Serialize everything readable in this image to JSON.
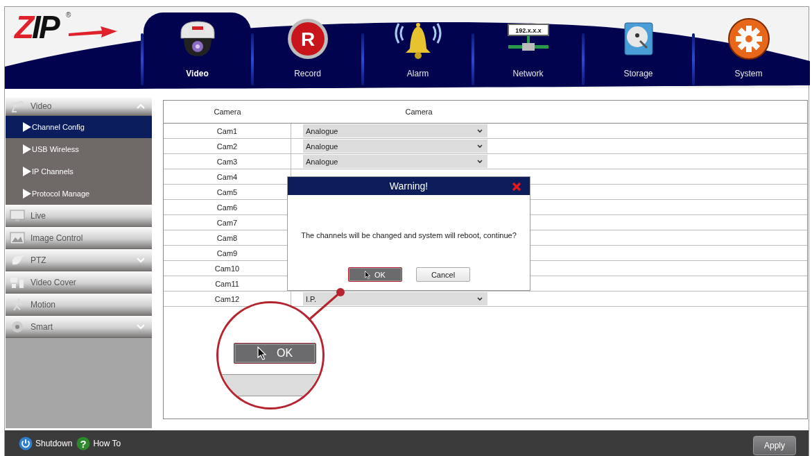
{
  "logo": {
    "text": "ZIP",
    "registered_mark": "®"
  },
  "nav_tabs": [
    {
      "label": "Video",
      "selected": true
    },
    {
      "label": "Record",
      "selected": false,
      "icon_text": "R"
    },
    {
      "label": "Alarm",
      "selected": false
    },
    {
      "label": "Network",
      "selected": false,
      "icon_text": "192.x.x.x"
    },
    {
      "label": "Storage",
      "selected": false
    },
    {
      "label": "System",
      "selected": false
    }
  ],
  "sidebar": {
    "items": [
      {
        "label": "Video",
        "expanded": true,
        "children": [
          {
            "label": "Channel Config",
            "selected": true
          },
          {
            "label": "USB Wireless",
            "selected": false
          },
          {
            "label": "IP Channels",
            "selected": false
          },
          {
            "label": "Protocol Manage",
            "selected": false
          }
        ]
      },
      {
        "label": "Live"
      },
      {
        "label": "Image Control"
      },
      {
        "label": "PTZ",
        "expanded": false
      },
      {
        "label": "Video Cover"
      },
      {
        "label": "Motion"
      },
      {
        "label": "Smart",
        "expanded": false
      }
    ]
  },
  "table": {
    "columns": [
      "Camera",
      "Camera"
    ],
    "rows": [
      {
        "name": "Cam1",
        "type": "Analogue"
      },
      {
        "name": "Cam2",
        "type": "Analogue"
      },
      {
        "name": "Cam3",
        "type": "Analogue"
      },
      {
        "name": "Cam4"
      },
      {
        "name": "Cam5"
      },
      {
        "name": "Cam6"
      },
      {
        "name": "Cam7"
      },
      {
        "name": "Cam8"
      },
      {
        "name": "Cam9"
      },
      {
        "name": "Cam10"
      },
      {
        "name": "Cam11"
      },
      {
        "name": "Cam12",
        "type": "I.P."
      }
    ]
  },
  "dialog": {
    "title": "Warning!",
    "message": "The channels will be changed and system will reboot, continue?",
    "buttons": [
      {
        "label": "OK",
        "selected": true
      },
      {
        "label": "Cancel",
        "selected": false
      }
    ]
  },
  "callout": {
    "button": "OK"
  },
  "footer": {
    "items": [
      {
        "label": "Shutdown"
      },
      {
        "label": "How To",
        "icon_text": "?"
      }
    ],
    "apply_button": "Apply"
  }
}
